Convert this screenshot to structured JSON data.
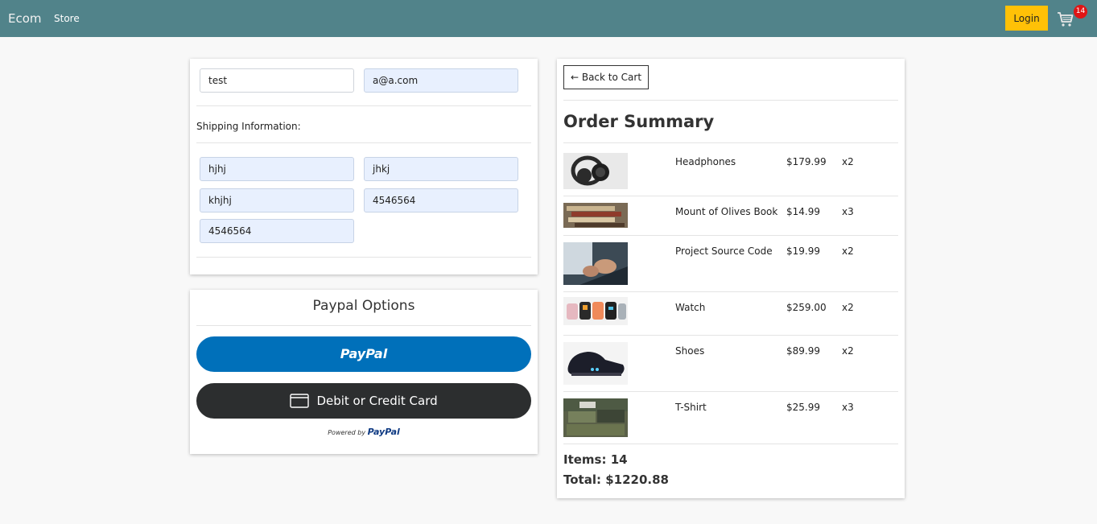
{
  "nav": {
    "brand": "Ecom",
    "store_label": "Store",
    "login_label": "Login",
    "cart_count": "14",
    "cart_icon": "cart-icon",
    "bar_color": "#51838a",
    "login_color": "#ffc107"
  },
  "form": {
    "name_value": "test",
    "email_value": "a@a.com",
    "shipping_label": "Shipping Information:",
    "address_value": "hjhj",
    "city_value": "jhkj",
    "state_value": "khjhj",
    "zipcode_value": "4546564",
    "country_value": "4546564"
  },
  "paypal": {
    "title": "Paypal Options",
    "paypal_button": "PayPal",
    "card_button": "Debit or Credit Card",
    "powered_by": "Powered by",
    "powered_brand": "PayPal",
    "paypal_color": "#0070ba",
    "card_color": "#2c2e2f"
  },
  "summary": {
    "back_label": "← Back to Cart",
    "title": "Order Summary",
    "items": [
      {
        "name": "Headphones",
        "price": "$179.99",
        "qty": "x2"
      },
      {
        "name": "Mount of Olives Book",
        "price": "$14.99",
        "qty": "x3"
      },
      {
        "name": "Project Source Code",
        "price": "$19.99",
        "qty": "x2"
      },
      {
        "name": "Watch",
        "price": "$259.00",
        "qty": "x2"
      },
      {
        "name": "Shoes",
        "price": "$89.99",
        "qty": "x2"
      },
      {
        "name": "T-Shirt",
        "price": "$25.99",
        "qty": "x3"
      }
    ],
    "items_total": "Items: 14",
    "price_total": "Total: $1220.88"
  }
}
